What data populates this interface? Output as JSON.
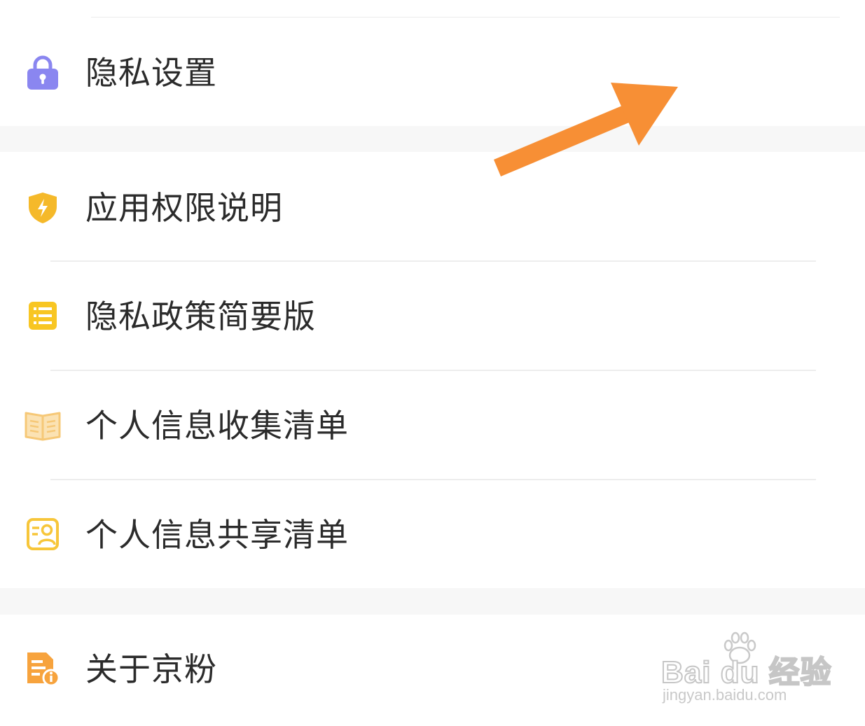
{
  "menu": {
    "items": [
      {
        "label": "隐私设置",
        "icon": "lock-icon",
        "icon_color": "#8a86f0"
      },
      {
        "label": "应用权限说明",
        "icon": "shield-icon",
        "icon_color": "#f5b92a"
      },
      {
        "label": "隐私政策简要版",
        "icon": "list-icon",
        "icon_color": "#f8c623"
      },
      {
        "label": "个人信息收集清单",
        "icon": "open-book-icon",
        "icon_color": "#f6c877"
      },
      {
        "label": "个人信息共享清单",
        "icon": "share-contact-icon",
        "icon_color": "#f7c63a"
      },
      {
        "label": "关于京粉",
        "icon": "info-document-icon",
        "icon_color": "#f7a33d"
      }
    ]
  },
  "annotation": {
    "arrow_color": "#f78f35"
  },
  "watermark": {
    "brand": "Bai du 经验",
    "url": "jingyan.baidu.com"
  }
}
